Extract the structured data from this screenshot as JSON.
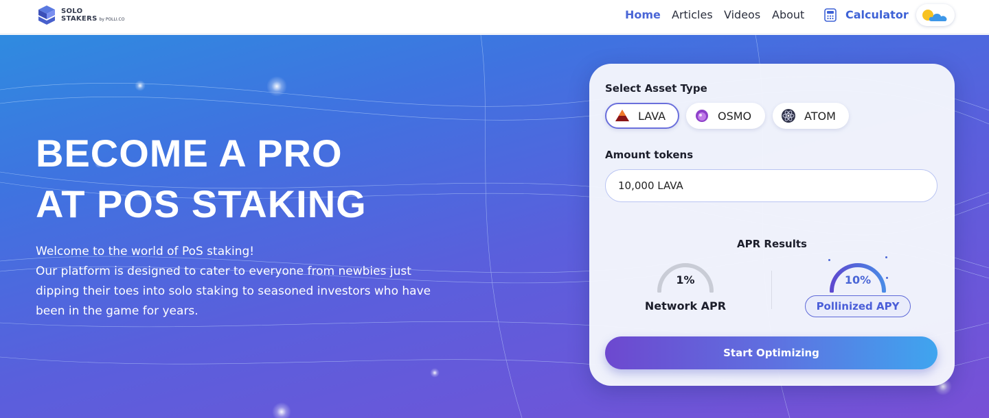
{
  "brand": {
    "line1": "SOLO",
    "line2": "STAKERS",
    "by": "by POLLI.CO"
  },
  "nav": {
    "home": "Home",
    "articles": "Articles",
    "videos": "Videos",
    "about": "About",
    "calculator": "Calculator"
  },
  "hero": {
    "headline_line1": "BECOME A PRO",
    "headline_line2": "AT POS STAKING",
    "welcome": "Welcome to the world of PoS staking!",
    "description": "Our platform is designed to cater to everyone from newbies just dipping their toes into solo staking to seasoned investors who have been in the game for years."
  },
  "calculator": {
    "asset_type_label": "Select Asset Type",
    "assets": [
      {
        "label": "LAVA",
        "icon": "lava-icon",
        "selected": true
      },
      {
        "label": "OSMO",
        "icon": "osmo-icon",
        "selected": false
      },
      {
        "label": "ATOM",
        "icon": "atom-icon",
        "selected": false
      }
    ],
    "amount_label": "Amount tokens",
    "amount_value": "10,000 LAVA",
    "results_title": "APR Results",
    "network_apr_value": "1%",
    "network_apr_label": "Network APR",
    "pollinized_apy_value": "10%",
    "pollinized_apy_label": "Pollinized APY",
    "cta_label": "Start Optimizing"
  },
  "colors": {
    "accent": "#4a66d6",
    "hero_start": "#2f8be0",
    "hero_end": "#7850d6",
    "sun": "#f7c221",
    "cloud": "#3d97e8"
  }
}
